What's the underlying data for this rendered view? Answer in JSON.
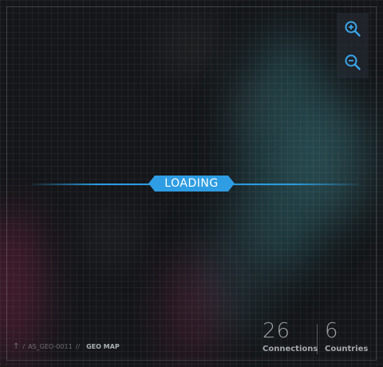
{
  "map": {
    "status_text": "LOADING",
    "accent_color": "#2e9de3"
  },
  "zoom": {
    "in_icon": "zoom-in-icon",
    "out_icon": "zoom-out-icon"
  },
  "breadcrumb": {
    "path": "AS_GEO-0011",
    "current": "GEO MAP"
  },
  "stats": {
    "connections_value": "26",
    "connections_label": "Connections",
    "countries_value": "6",
    "countries_label": "Countries"
  }
}
